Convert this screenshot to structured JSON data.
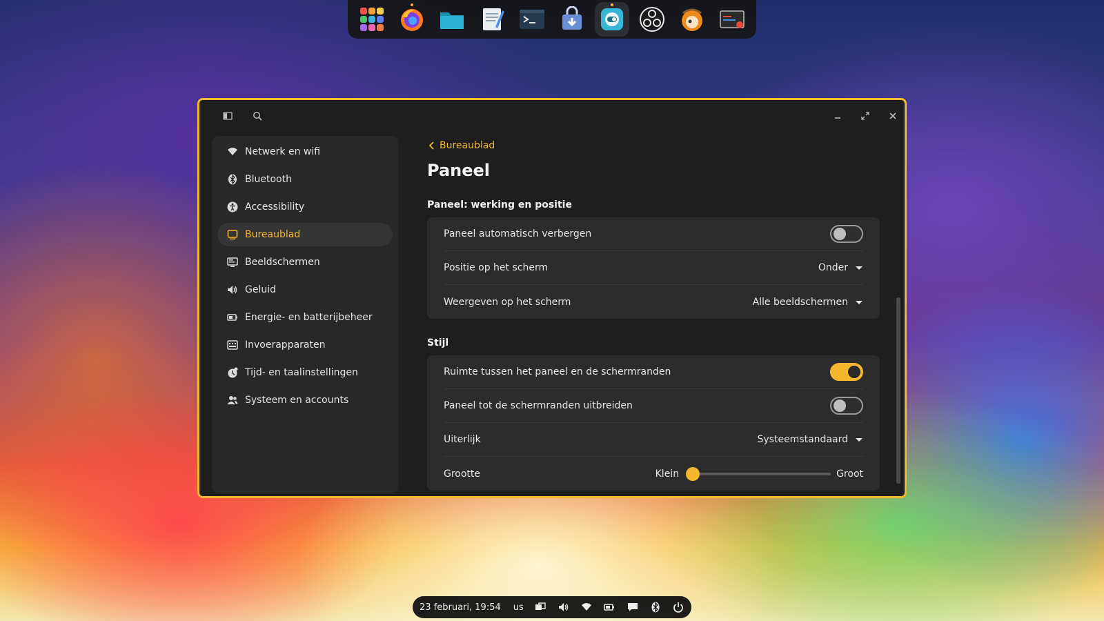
{
  "dock": {
    "items": [
      {
        "name": "app-grid-icon",
        "active": false
      },
      {
        "name": "firefox-icon",
        "active": false,
        "running": true
      },
      {
        "name": "files-icon",
        "active": false
      },
      {
        "name": "text-editor-icon",
        "active": false
      },
      {
        "name": "terminal-icon",
        "active": false
      },
      {
        "name": "store-icon",
        "active": false
      },
      {
        "name": "settings-icon",
        "active": true,
        "running": true
      },
      {
        "name": "obs-studio-icon",
        "active": false
      },
      {
        "name": "gimp-icon",
        "active": false
      },
      {
        "name": "system-monitor-icon",
        "active": false
      }
    ]
  },
  "window": {
    "accent_color": "#f5b72b",
    "sidebar": {
      "items": [
        {
          "label": "Netwerk en wifi",
          "icon": "wifi-icon"
        },
        {
          "label": "Bluetooth",
          "icon": "bluetooth-icon"
        },
        {
          "label": "Accessibility",
          "icon": "accessibility-icon"
        },
        {
          "label": "Bureaublad",
          "icon": "desktop-icon",
          "selected": true
        },
        {
          "label": "Beeldschermen",
          "icon": "display-icon"
        },
        {
          "label": "Geluid",
          "icon": "sound-icon"
        },
        {
          "label": "Energie- en batterijbeheer",
          "icon": "battery-icon"
        },
        {
          "label": "Invoerapparaten",
          "icon": "keyboard-icon"
        },
        {
          "label": "Tijd- en taalinstellingen",
          "icon": "time-language-icon"
        },
        {
          "label": "Systeem en accounts",
          "icon": "users-icon"
        }
      ]
    },
    "main": {
      "back_label": "Bureaublad",
      "title": "Paneel",
      "section1": {
        "title": "Paneel: werking en positie",
        "rows": {
          "autohide": {
            "label": "Paneel automatisch verbergen",
            "on": false
          },
          "position": {
            "label": "Positie op het scherm",
            "value": "Onder"
          },
          "display": {
            "label": "Weergeven op het scherm",
            "value": "Alle beeldschermen"
          }
        }
      },
      "section2": {
        "title": "Stijl",
        "rows": {
          "gap": {
            "label": "Ruimte tussen het paneel en de schermranden",
            "on": true
          },
          "extend": {
            "label": "Paneel tot de schermranden uitbreiden",
            "on": false
          },
          "appearance": {
            "label": "Uiterlijk",
            "value": "Systeemstandaard"
          },
          "size": {
            "label": "Grootte",
            "min_label": "Klein",
            "max_label": "Groot",
            "value_fraction": 0.0
          }
        }
      }
    }
  },
  "panel": {
    "clock": "23 februari, 19:54",
    "keyboard_layout": "us",
    "icons": [
      "workspaces-icon",
      "volume-icon",
      "wifi-icon",
      "battery-icon",
      "notifications-icon",
      "bluetooth-icon",
      "power-icon"
    ]
  }
}
